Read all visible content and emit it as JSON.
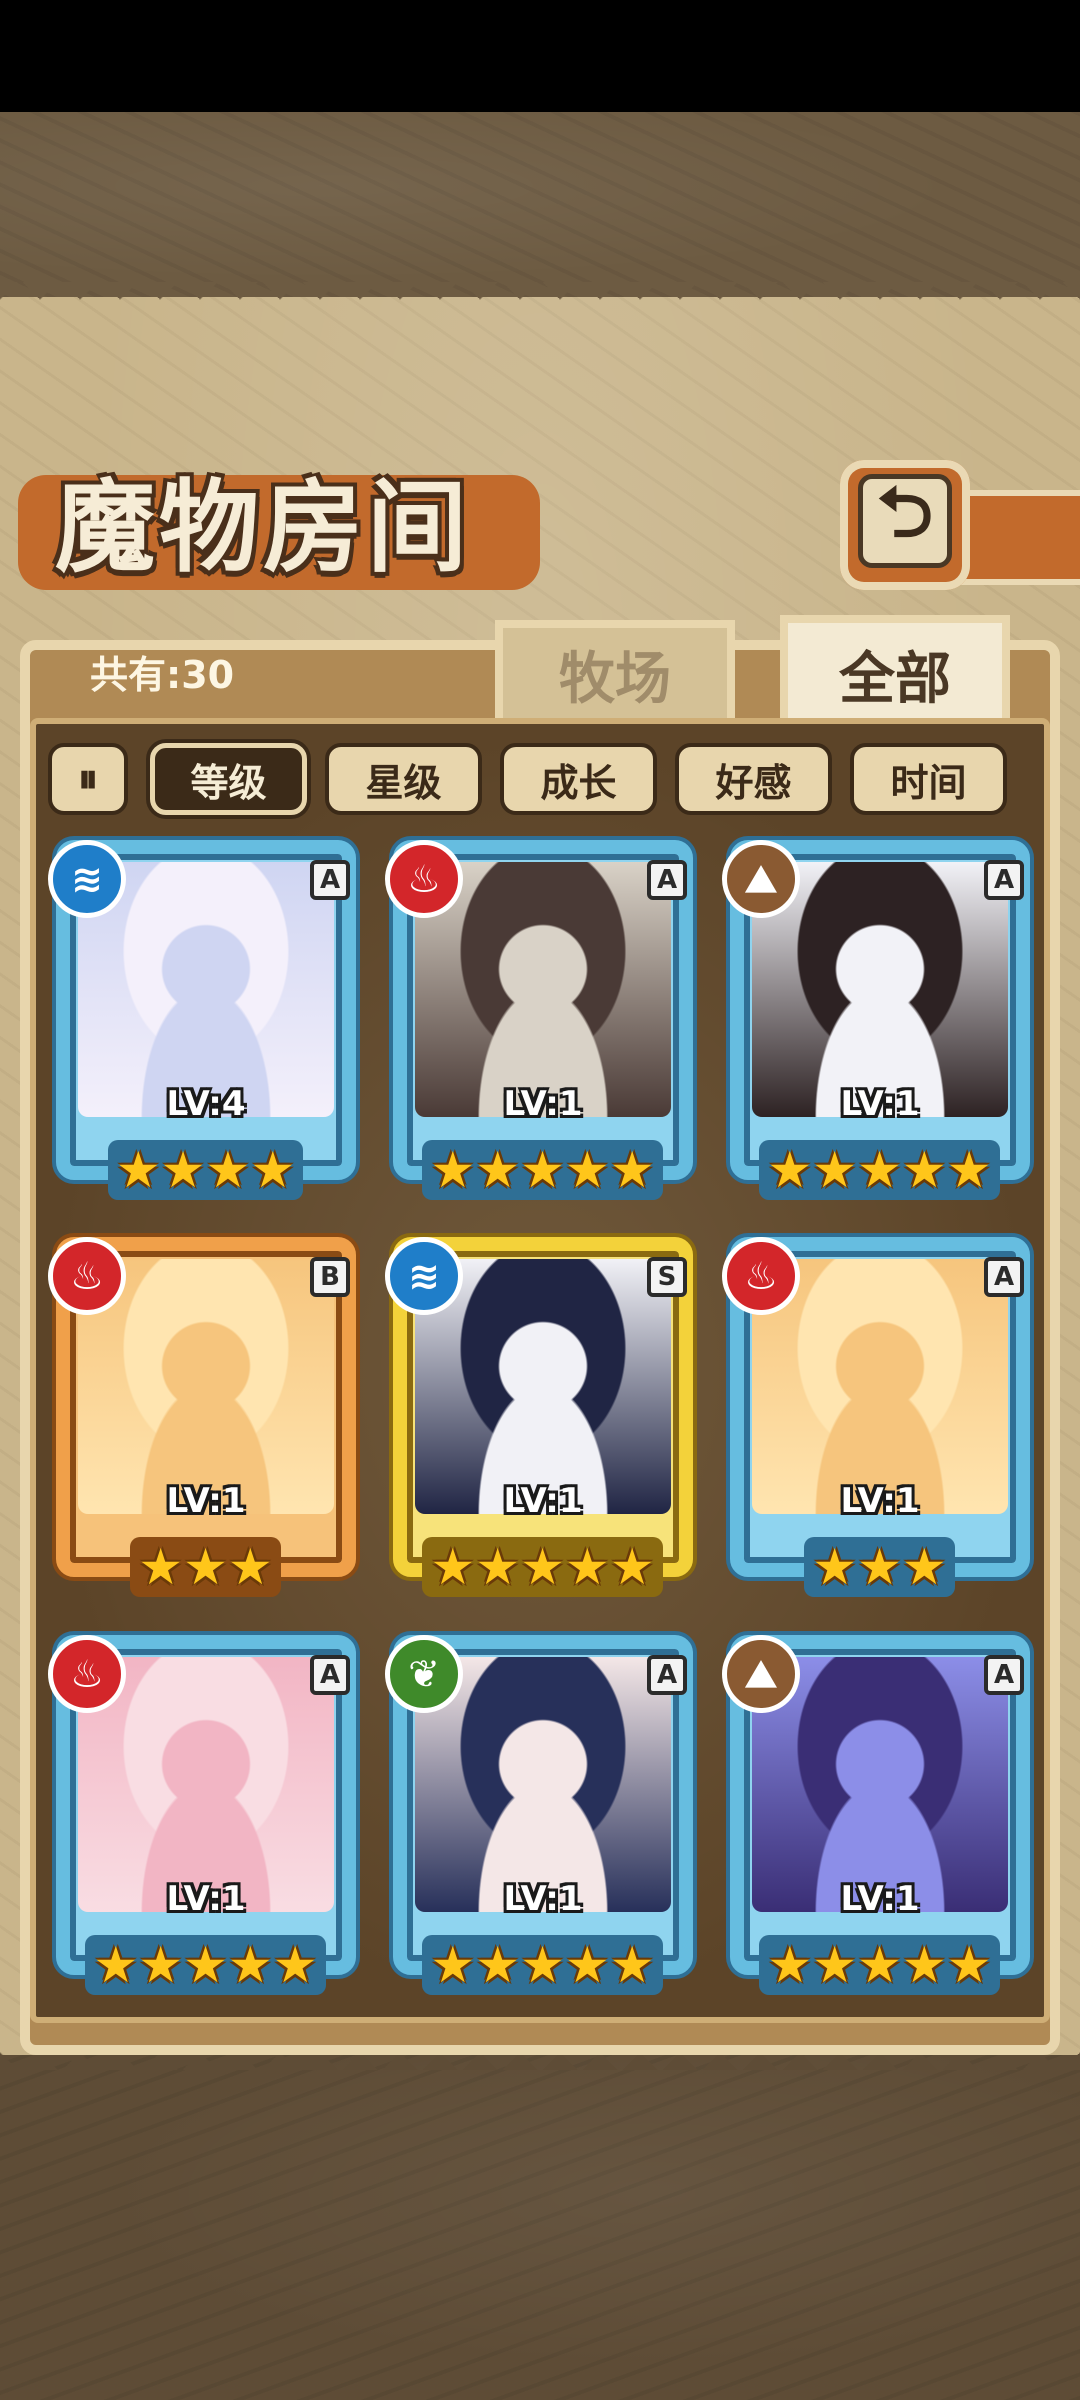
{
  "screen": {
    "title": "魔物房间",
    "back_icon": "return-arrow-icon",
    "count_label": "共有:30"
  },
  "tabs": [
    {
      "label": "牧场",
      "selected": false
    },
    {
      "label": "全部",
      "selected": true
    }
  ],
  "sort": {
    "toggle_icon": "pause-sort-icon",
    "toggle_glyph": "⏸",
    "options": [
      {
        "label": "等级",
        "active": true
      },
      {
        "label": "星级",
        "active": false
      },
      {
        "label": "成长",
        "active": false
      },
      {
        "label": "好感",
        "active": false
      },
      {
        "label": "时间",
        "active": false
      }
    ]
  },
  "monsters": [
    {
      "element": "water",
      "element_glyph": "≋",
      "rank": "A",
      "level": "LV:4",
      "stars": 4,
      "palette": [
        "#f4f0fb",
        "#cfd5f2",
        "#a8c8e8"
      ]
    },
    {
      "element": "fire",
      "element_glyph": "♨",
      "rank": "A",
      "level": "LV:1",
      "stars": 5,
      "palette": [
        "#4a3a36",
        "#d9d2c7",
        "#8f1f24"
      ]
    },
    {
      "element": "earth",
      "element_glyph": "⛰",
      "rank": "A",
      "level": "LV:1",
      "stars": 5,
      "palette": [
        "#2d2223",
        "#f2f2f7",
        "#b01b23"
      ]
    },
    {
      "element": "fire",
      "element_glyph": "♨",
      "rank": "B",
      "level": "LV:1",
      "stars": 3,
      "palette": [
        "#ffe5b0",
        "#f6c57d",
        "#8e3a1c"
      ]
    },
    {
      "element": "water",
      "element_glyph": "≋",
      "rank": "S",
      "level": "LV:1",
      "stars": 5,
      "palette": [
        "#202544",
        "#f1f1f6",
        "#e8b84a"
      ]
    },
    {
      "element": "fire",
      "element_glyph": "♨",
      "rank": "A",
      "level": "LV:1",
      "stars": 3,
      "palette": [
        "#ffe5b0",
        "#f6c57d",
        "#8e3a1c"
      ]
    },
    {
      "element": "fire",
      "element_glyph": "♨",
      "rank": "A",
      "level": "LV:1",
      "stars": 5,
      "palette": [
        "#f9dde3",
        "#f2b5c4",
        "#c73750"
      ]
    },
    {
      "element": "wood",
      "element_glyph": "❦",
      "rank": "A",
      "level": "LV:1",
      "stars": 5,
      "palette": [
        "#27305a",
        "#f4e7e7",
        "#5a6ab8"
      ]
    },
    {
      "element": "earth",
      "element_glyph": "⛰",
      "rank": "A",
      "level": "LV:1",
      "stars": 5,
      "palette": [
        "#3a2e75",
        "#8c8ee8",
        "#4fb1e8"
      ]
    }
  ]
}
